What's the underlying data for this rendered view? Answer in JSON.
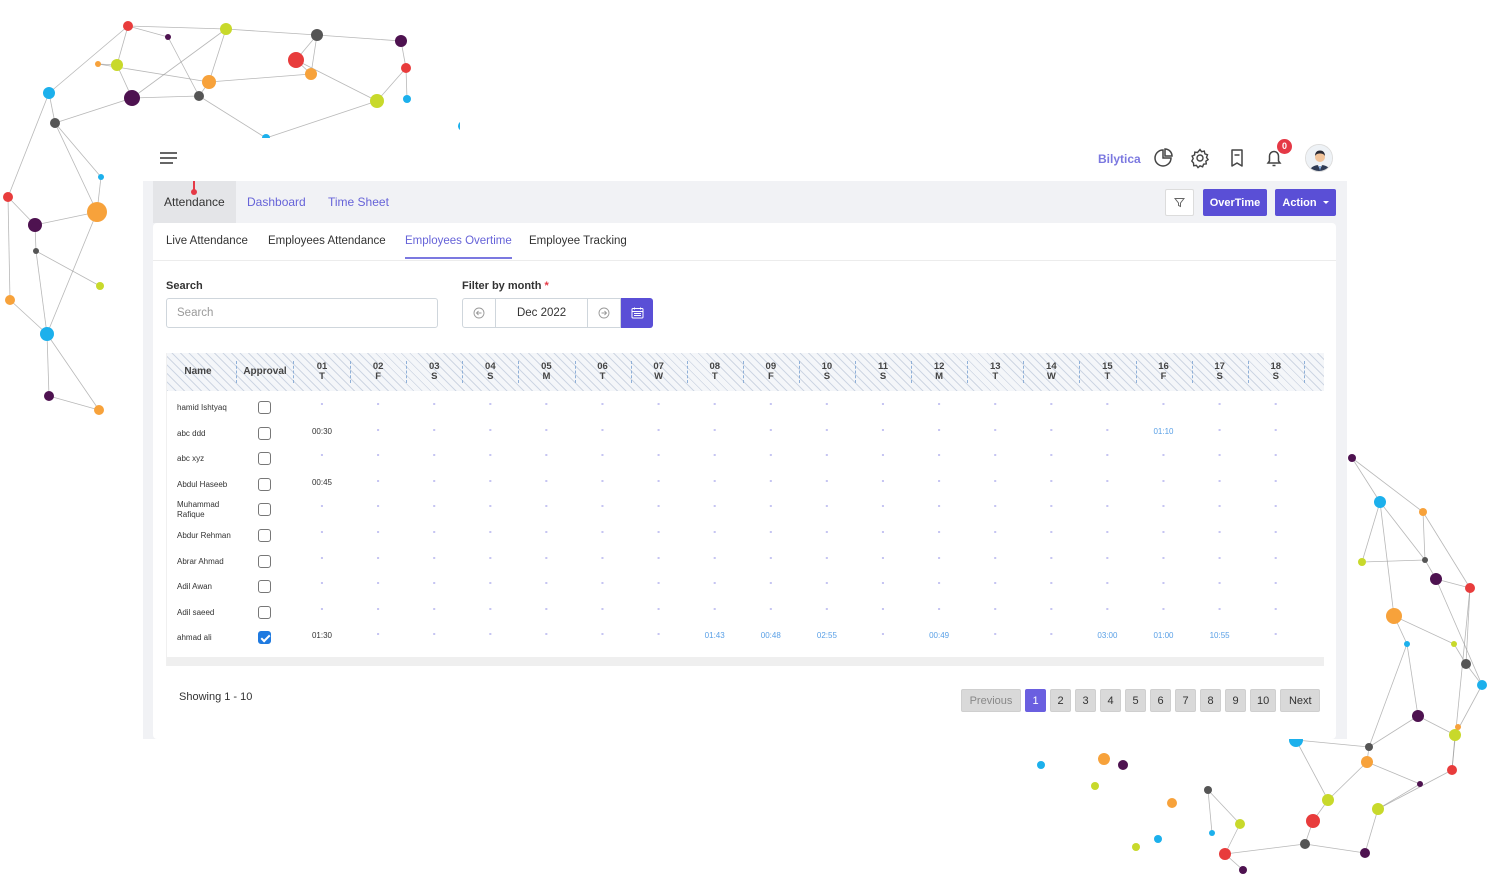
{
  "topbar": {
    "brand": "Bilytica",
    "icons": [
      "pie-chart-icon",
      "gear-icon",
      "bookmark-icon",
      "bell-icon"
    ],
    "notification_count": "0"
  },
  "nav": {
    "tabs": [
      {
        "label": "Attendance",
        "active": true
      },
      {
        "label": "Dashboard",
        "active": false
      },
      {
        "label": "Time Sheet",
        "active": false
      }
    ],
    "filter_icon": "filter-icon",
    "overtime_label": "OverTime",
    "action_label": "Action",
    "accent": "#5a4fd6"
  },
  "subtabs": [
    {
      "label": "Live Attendance",
      "active": false
    },
    {
      "label": "Employees Attendance",
      "active": false
    },
    {
      "label": "Employees Overtime",
      "active": true
    },
    {
      "label": "Employee Tracking",
      "active": false
    }
  ],
  "filters": {
    "search_label": "Search",
    "search_placeholder": "Search",
    "search_value": "",
    "month_label": "Filter by month",
    "month_required": "*",
    "month_value": "Dec 2022"
  },
  "table": {
    "headers": {
      "name": "Name",
      "approval": "Approval"
    },
    "days": [
      {
        "d": "01",
        "w": "T"
      },
      {
        "d": "02",
        "w": "F"
      },
      {
        "d": "03",
        "w": "S"
      },
      {
        "d": "04",
        "w": "S"
      },
      {
        "d": "05",
        "w": "M"
      },
      {
        "d": "06",
        "w": "T"
      },
      {
        "d": "07",
        "w": "W"
      },
      {
        "d": "08",
        "w": "T"
      },
      {
        "d": "09",
        "w": "F"
      },
      {
        "d": "10",
        "w": "S"
      },
      {
        "d": "11",
        "w": "S"
      },
      {
        "d": "12",
        "w": "M"
      },
      {
        "d": "13",
        "w": "T"
      },
      {
        "d": "14",
        "w": "W"
      },
      {
        "d": "15",
        "w": "T"
      },
      {
        "d": "16",
        "w": "F"
      },
      {
        "d": "17",
        "w": "S"
      },
      {
        "d": "18",
        "w": "S"
      }
    ],
    "rows": [
      {
        "name": "hamid Ishtyaq",
        "approved": false,
        "values": [
          "-",
          "-",
          "-",
          "-",
          "-",
          "-",
          "-",
          "-",
          "-",
          "-",
          "-",
          "-",
          "-",
          "-",
          "-",
          "-",
          "-",
          "-"
        ]
      },
      {
        "name": "abc ddd",
        "approved": false,
        "values": [
          "00:30",
          "-",
          "-",
          "-",
          "-",
          "-",
          "-",
          "-",
          "-",
          "-",
          "-",
          "-",
          "-",
          "-",
          "-",
          "01:10",
          "-",
          "-"
        ]
      },
      {
        "name": "abc xyz",
        "approved": false,
        "values": [
          "-",
          "-",
          "-",
          "-",
          "-",
          "-",
          "-",
          "-",
          "-",
          "-",
          "-",
          "-",
          "-",
          "-",
          "-",
          "-",
          "-",
          "-"
        ]
      },
      {
        "name": "Abdul Haseeb",
        "approved": false,
        "values": [
          "00:45",
          "-",
          "-",
          "-",
          "-",
          "-",
          "-",
          "-",
          "-",
          "-",
          "-",
          "-",
          "-",
          "-",
          "-",
          "-",
          "-",
          "-"
        ]
      },
      {
        "name": "Muhammad Rafique",
        "approved": false,
        "values": [
          "-",
          "-",
          "-",
          "-",
          "-",
          "-",
          "-",
          "-",
          "-",
          "-",
          "-",
          "-",
          "-",
          "-",
          "-",
          "-",
          "-",
          "-"
        ]
      },
      {
        "name": "Abdur Rehman",
        "approved": false,
        "values": [
          "-",
          "-",
          "-",
          "-",
          "-",
          "-",
          "-",
          "-",
          "-",
          "-",
          "-",
          "-",
          "-",
          "-",
          "-",
          "-",
          "-",
          "-"
        ]
      },
      {
        "name": "Abrar Ahmad",
        "approved": false,
        "values": [
          "-",
          "-",
          "-",
          "-",
          "-",
          "-",
          "-",
          "-",
          "-",
          "-",
          "-",
          "-",
          "-",
          "-",
          "-",
          "-",
          "-",
          "-"
        ]
      },
      {
        "name": "Adil Awan",
        "approved": false,
        "values": [
          "-",
          "-",
          "-",
          "-",
          "-",
          "-",
          "-",
          "-",
          "-",
          "-",
          "-",
          "-",
          "-",
          "-",
          "-",
          "-",
          "-",
          "-"
        ]
      },
      {
        "name": "Adil saeed",
        "approved": false,
        "values": [
          "-",
          "-",
          "-",
          "-",
          "-",
          "-",
          "-",
          "-",
          "-",
          "-",
          "-",
          "-",
          "-",
          "-",
          "-",
          "-",
          "-",
          "-"
        ]
      },
      {
        "name": "ahmad ali",
        "approved": true,
        "values": [
          "01:30",
          "-",
          "-",
          "-",
          "-",
          "-",
          "-",
          "01:43",
          "00:48",
          "02:55",
          "-",
          "00:49",
          "-",
          "-",
          "03:00",
          "01:00",
          "10:55",
          "-"
        ]
      }
    ]
  },
  "footer": {
    "showing": "Showing 1 - 10",
    "previous": "Previous",
    "next": "Next",
    "pages": [
      "1",
      "2",
      "3",
      "4",
      "5",
      "6",
      "7",
      "8",
      "9",
      "10"
    ],
    "current_page": "1"
  }
}
